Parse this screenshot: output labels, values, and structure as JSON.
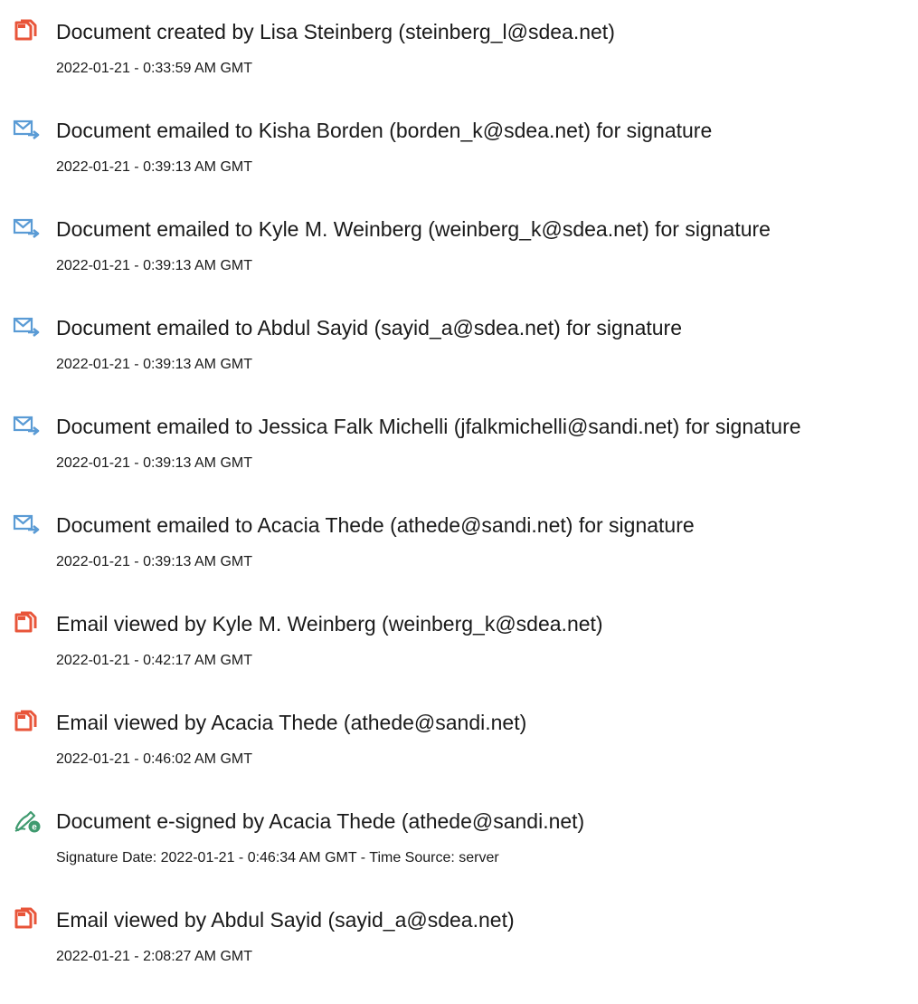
{
  "colors": {
    "created_icon": "#e8553a",
    "emailed_icon": "#5a9bd5",
    "esigned_icon": "#3f9a6f",
    "text": "#1a1a1a"
  },
  "events": [
    {
      "icon": "document-icon",
      "title": "Document created by Lisa Steinberg (steinberg_l@sdea.net)",
      "time": "2022-01-21 - 0:33:59 AM GMT"
    },
    {
      "icon": "email-icon",
      "title": "Document emailed to Kisha Borden (borden_k@sdea.net) for signature",
      "time": "2022-01-21 - 0:39:13 AM GMT"
    },
    {
      "icon": "email-icon",
      "title": "Document emailed to Kyle M. Weinberg (weinberg_k@sdea.net) for signature",
      "time": "2022-01-21 - 0:39:13 AM GMT"
    },
    {
      "icon": "email-icon",
      "title": "Document emailed to Abdul Sayid (sayid_a@sdea.net) for signature",
      "time": "2022-01-21 - 0:39:13 AM GMT"
    },
    {
      "icon": "email-icon",
      "title": "Document emailed to Jessica Falk Michelli (jfalkmichelli@sandi.net) for signature",
      "time": "2022-01-21 - 0:39:13 AM GMT"
    },
    {
      "icon": "email-icon",
      "title": "Document emailed to Acacia Thede (athede@sandi.net) for signature",
      "time": "2022-01-21 - 0:39:13 AM GMT"
    },
    {
      "icon": "document-icon",
      "title": "Email viewed by Kyle M. Weinberg (weinberg_k@sdea.net)",
      "time": "2022-01-21 - 0:42:17 AM GMT"
    },
    {
      "icon": "document-icon",
      "title": "Email viewed by Acacia Thede (athede@sandi.net)",
      "time": "2022-01-21 - 0:46:02 AM GMT"
    },
    {
      "icon": "esign-icon",
      "title": "Document e-signed by Acacia Thede (athede@sandi.net)",
      "time": "Signature Date: 2022-01-21 - 0:46:34 AM GMT - Time Source: server"
    },
    {
      "icon": "document-icon",
      "title": "Email viewed by Abdul Sayid (sayid_a@sdea.net)",
      "time": "2022-01-21 - 2:08:27 AM GMT"
    }
  ]
}
